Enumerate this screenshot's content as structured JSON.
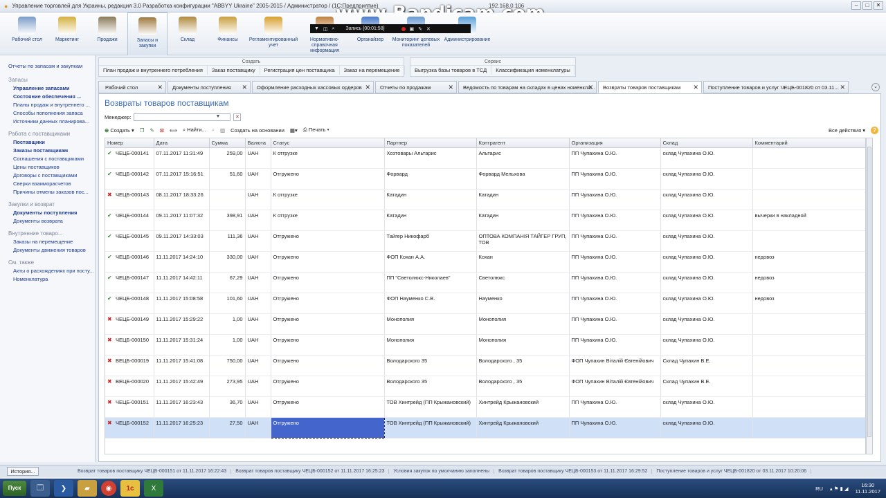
{
  "window": {
    "title": "Управление торговлей для Украины, редакция 3.0 Разработка конфигурации \"ABBYY Ukraine\" 2005-2015 / Администратор / (1С:Предприятие)",
    "address": "192.168.0.106",
    "watermark": "www.Bandicam.com"
  },
  "recorder": {
    "label": "Запись [00:01:58]"
  },
  "sections": [
    {
      "label": "Рабочий стол",
      "icon": "desktop-icon",
      "color": "#7a9cc8"
    },
    {
      "label": "Маркетинг",
      "icon": "marketing-icon",
      "color": "#d4b040"
    },
    {
      "label": "Продажи",
      "icon": "sales-icon",
      "color": "#8a7a5a"
    },
    {
      "label": "Запасы и закупки",
      "icon": "inventory-icon",
      "color": "#a07a40",
      "active": true
    },
    {
      "label": "Склад",
      "icon": "warehouse-icon",
      "color": "#b08a40"
    },
    {
      "label": "Финансы",
      "icon": "finance-icon",
      "color": "#c9a040"
    },
    {
      "label": "Регламентированный учет",
      "icon": "accounting-icon",
      "color": "#d8a030"
    },
    {
      "label": "Нормативно-справочная информация",
      "icon": "reference-icon",
      "color": "#c08040"
    },
    {
      "label": "Органайзер",
      "icon": "organizer-icon",
      "color": "#4a7ac8"
    },
    {
      "label": "Мониторинг целевых показателей",
      "icon": "monitoring-icon",
      "color": "#6a9ad0"
    },
    {
      "label": "Администрирование",
      "icon": "admin-icon",
      "color": "#5aa0d8"
    }
  ],
  "leftnav": {
    "top_link": "Отчеты по запасам и закупкам",
    "groups": [
      {
        "title": "Запасы",
        "items": [
          {
            "label": "Управление запасами",
            "bold": true
          },
          {
            "label": "Состояние обеспечения ...",
            "bold": true
          },
          {
            "label": "Планы продаж и внутреннего ...",
            "bold": false
          },
          {
            "label": "Способы пополнения запаса",
            "bold": false
          },
          {
            "label": "Источники данных планирова...",
            "bold": false
          }
        ]
      },
      {
        "title": "Работа с поставщиками",
        "items": [
          {
            "label": "Поставщики",
            "bold": true
          },
          {
            "label": "Заказы поставщикам",
            "bold": true
          },
          {
            "label": "Соглашения с поставщиками",
            "bold": false
          },
          {
            "label": "Цены поставщиков",
            "bold": false
          },
          {
            "label": "Договоры с поставщиками",
            "bold": false
          },
          {
            "label": "Сверки взаиморасчетов",
            "bold": false
          },
          {
            "label": "Причины отмены заказов пос...",
            "bold": false
          }
        ]
      },
      {
        "title": "Закупки и возврат",
        "items": [
          {
            "label": "Документы поступления",
            "bold": true
          },
          {
            "label": "Документы возврата",
            "bold": false
          }
        ]
      },
      {
        "title": "Внутренние товаро...",
        "items": [
          {
            "label": "Заказы на перемещение",
            "bold": false
          },
          {
            "label": "Документы движения товаров",
            "bold": false
          }
        ]
      },
      {
        "title": "См. также",
        "items": [
          {
            "label": "Акты о расхождениях при посту...",
            "bold": false
          },
          {
            "label": "Номенклатура",
            "bold": false
          }
        ]
      }
    ]
  },
  "commands": {
    "create": {
      "caption": "Создать",
      "items": [
        "План продаж и внутреннего потребления",
        "Заказ поставщику",
        "Регистрация цен поставщика",
        "Заказ на перемещение"
      ]
    },
    "service": {
      "caption": "Сервис",
      "items": [
        "Выгрузка базы товаров в ТСД",
        "Классификация номенклатуры"
      ]
    }
  },
  "tabs": [
    {
      "label": "Рабочий стол",
      "active": false
    },
    {
      "label": "Документы поступления",
      "active": false
    },
    {
      "label": "Оформление расходных кассовых ордеров",
      "active": false
    },
    {
      "label": "Отчеты по продажам",
      "active": false
    },
    {
      "label": "Ведомость по товарам на складах в ценах номенкла...",
      "active": false
    },
    {
      "label": "Возвраты товаров поставщикам",
      "active": true
    },
    {
      "label": "Поступление товаров и услуг ЧЕЦБ-001820 от 03.11...",
      "active": false
    }
  ],
  "page": {
    "title": "Возвраты товаров поставщикам",
    "manager_label": "Менеджер:",
    "manager_value": ""
  },
  "toolbar": {
    "create": "Создать",
    "find": "Найти...",
    "create_based_on": "Создать на основании",
    "print": "Печать",
    "all_actions": "Все действия"
  },
  "table": {
    "columns": [
      "Номер",
      "Дата",
      "Сумма",
      "Валюта",
      "Статус",
      "Партнер",
      "Контрагент",
      "Организация",
      "Склад",
      "Комментарий"
    ],
    "rows": [
      {
        "icon": "ok",
        "number": "ЧЕЦБ-000141",
        "date": "07.11.2017 11:31:49",
        "sum": "259,00",
        "currency": "UAH",
        "status": "К отгрузке",
        "partner": "Хозтовары Альтарис",
        "counterparty": "Альтарис",
        "org": "ПП Чупахина О.Ю.",
        "warehouse": "склад Чупахина О.Ю.",
        "comment": ""
      },
      {
        "icon": "ok",
        "number": "ЧЕЦБ-000142",
        "date": "07.11.2017 15:16:51",
        "sum": "51,60",
        "currency": "UAH",
        "status": "Отгружено",
        "partner": "Форвард",
        "counterparty": "Форвард Мельхова",
        "org": "ПП Чупахина О.Ю.",
        "warehouse": "склад Чупахина О.Ю.",
        "comment": ""
      },
      {
        "icon": "del",
        "number": "ЧЕЦБ-000143",
        "date": "08.11.2017 18:33:26",
        "sum": "",
        "currency": "UAH",
        "status": "К отгрузке",
        "partner": "Катадин",
        "counterparty": "Катадин",
        "org": "ПП Чупахина О.Ю.",
        "warehouse": "склад Чупахина О.Ю.",
        "comment": ""
      },
      {
        "icon": "ok",
        "number": "ЧЕЦБ-000144",
        "date": "09.11.2017 11:07:32",
        "sum": "398,91",
        "currency": "UAH",
        "status": "К отгрузке",
        "partner": "Катадин",
        "counterparty": "Катадин",
        "org": "ПП Чупахина О.Ю.",
        "warehouse": "склад Чупахина О.Ю.",
        "comment": "вычерки в накладной"
      },
      {
        "icon": "ok",
        "number": "ЧЕЦБ-000145",
        "date": "09.11.2017 14:33:03",
        "sum": "111,36",
        "currency": "UAH",
        "status": "Отгружено",
        "partner": "Тайгер Никофарб",
        "counterparty": "ОПТОВА КОМПАНІЯ ТАЙГЕР ГРУП, ТОВ",
        "org": "ПП Чупахина О.Ю.",
        "warehouse": "склад Чупахина О.Ю.",
        "comment": ""
      },
      {
        "icon": "ok",
        "number": "ЧЕЦБ-000146",
        "date": "11.11.2017 14:24:10",
        "sum": "330,00",
        "currency": "UAH",
        "status": "Отгружено",
        "partner": "ФОП Кохан А.А.",
        "counterparty": "Кохан",
        "org": "ПП Чупахина О.Ю.",
        "warehouse": "склад Чупахина О.Ю.",
        "comment": "недовоз"
      },
      {
        "icon": "ok",
        "number": "ЧЕЦБ-000147",
        "date": "11.11.2017 14:42:11",
        "sum": "67,29",
        "currency": "UAH",
        "status": "Отгружено",
        "partner": "ПП \"Светолюкс-Николаев\"",
        "counterparty": "Светолюкс",
        "org": "ПП Чупахина О.Ю.",
        "warehouse": "склад Чупахина О.Ю.",
        "comment": "недовоз"
      },
      {
        "icon": "ok",
        "number": "ЧЕЦБ-000148",
        "date": "11.11.2017 15:08:58",
        "sum": "101,60",
        "currency": "UAH",
        "status": "Отгружено",
        "partner": "ФОП Науменко С.В.",
        "counterparty": "Науменко",
        "org": "ПП Чупахина О.Ю.",
        "warehouse": "склад Чупахина О.Ю.",
        "comment": "недовоз"
      },
      {
        "icon": "del",
        "number": "ЧЕЦБ-000149",
        "date": "11.11.2017 15:29:22",
        "sum": "1,00",
        "currency": "UAH",
        "status": "Отгружено",
        "partner": "Монополия",
        "counterparty": "Монополия",
        "org": "ПП Чупахина О.Ю.",
        "warehouse": "склад Чупахина О.Ю.",
        "comment": ""
      },
      {
        "icon": "del",
        "number": "ЧЕЦБ-000150",
        "date": "11.11.2017 15:31:24",
        "sum": "1,00",
        "currency": "UAH",
        "status": "Отгружено",
        "partner": "Монополия",
        "counterparty": "Монополия",
        "org": "ПП Чупахина О.Ю.",
        "warehouse": "склад Чупахина О.Ю.",
        "comment": ""
      },
      {
        "icon": "del",
        "number": "ВЕЦБ-000019",
        "date": "11.11.2017 15:41:08",
        "sum": "750,00",
        "currency": "UAH",
        "status": "Отгружено",
        "partner": "Володарского 35",
        "counterparty": "Володарского , 35",
        "org": "ФОП Чупахин Віталій Євгенійович",
        "warehouse": "Склад Чупахин В.Е.",
        "comment": ""
      },
      {
        "icon": "del",
        "number": "ВЕЦБ-000020",
        "date": "11.11.2017 15:42:49",
        "sum": "273,95",
        "currency": "UAH",
        "status": "Отгружено",
        "partner": "Володарского 35",
        "counterparty": "Володарского , 35",
        "org": "ФОП Чупахин Віталій Євгенійович",
        "warehouse": "Склад Чупахин В.Е.",
        "comment": ""
      },
      {
        "icon": "del",
        "number": "ЧЕЦБ-000151",
        "date": "11.11.2017 16:23:43",
        "sum": "36,70",
        "currency": "UAH",
        "status": "Отгружено",
        "partner": "ТОВ Хинтрейд (ПП Крыжановский)",
        "counterparty": "Хинтрейд Крыжановский",
        "org": "ПП Чупахина О.Ю.",
        "warehouse": "склад Чупахина О.Ю.",
        "comment": ""
      },
      {
        "icon": "del",
        "number": "ЧЕЦБ-000152",
        "date": "11.11.2017 16:25:23",
        "sum": "27,50",
        "currency": "UAH",
        "status": "Отгружено",
        "partner": "ТОВ Хинтрейд (ПП Крыжановский)",
        "counterparty": "Хинтрейд Крыжановский",
        "org": "ПП Чупахина О.Ю.",
        "warehouse": "склад Чупахина О.Ю.",
        "comment": "",
        "selected": true
      }
    ]
  },
  "history": {
    "button": "История...",
    "items": [
      "Возврат товаров поставщику ЧЕЦБ-000151 от 11.11.2017 16:22:43",
      "Возврат товаров поставщику ЧЕЦБ-000152 от 11.11.2017 16:25:23",
      "Условия закупок по умолчанию заполнены",
      "Возврат товаров поставщику ЧЕЦБ-000153 от 11.11.2017 16:29:52",
      "Поступление товаров и услуг ЧЕЦБ-001820 от 03.11.2017 10:20:06"
    ]
  },
  "taskbar": {
    "start": "Пуск",
    "lang": "RU",
    "time": "16:30",
    "date": "11.11.2017"
  }
}
